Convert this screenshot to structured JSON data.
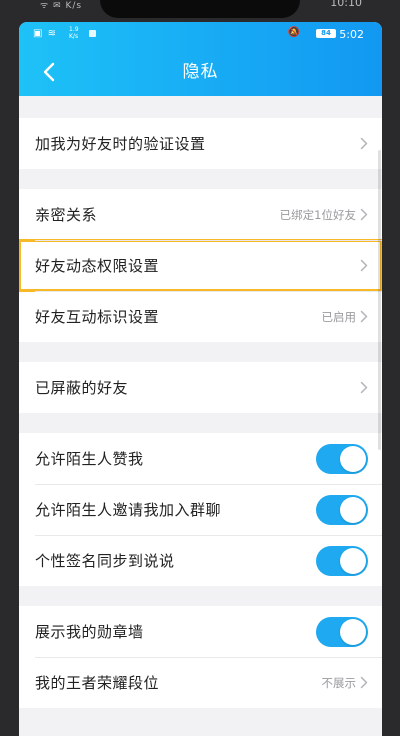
{
  "outer_status": {
    "left": "ᯤ ✉ K/s",
    "time": "10:10"
  },
  "status_bar": {
    "left_icons": "▣ ≋",
    "network_speed": "1.9\nK/s",
    "battery": "84",
    "time": "5:02"
  },
  "header": {
    "title": "隐私"
  },
  "sections": [
    {
      "rows": [
        {
          "label": "加我为好友时的验证设置",
          "value": ""
        }
      ]
    },
    {
      "rows": [
        {
          "label": "亲密关系",
          "value": "已绑定1位好友"
        },
        {
          "label": "好友动态权限设置",
          "value": ""
        },
        {
          "label": "好友互动标识设置",
          "value": "已启用"
        }
      ]
    },
    {
      "rows": [
        {
          "label": "已屏蔽的好友",
          "value": ""
        }
      ]
    },
    {
      "rows": [
        {
          "label": "允许陌生人赞我",
          "toggle": true
        },
        {
          "label": "允许陌生人邀请我加入群聊",
          "toggle": true
        },
        {
          "label": "个性签名同步到说说",
          "toggle": true
        }
      ]
    },
    {
      "rows": [
        {
          "label": "展示我的勋章墙",
          "toggle": true
        },
        {
          "label": "我的王者荣耀段位",
          "value": "不展示"
        }
      ]
    }
  ],
  "colors": {
    "header_start": "#1ec2f7",
    "header_end": "#1298f2",
    "toggle_on": "#1ea9f0",
    "highlight": "#f7b928"
  }
}
